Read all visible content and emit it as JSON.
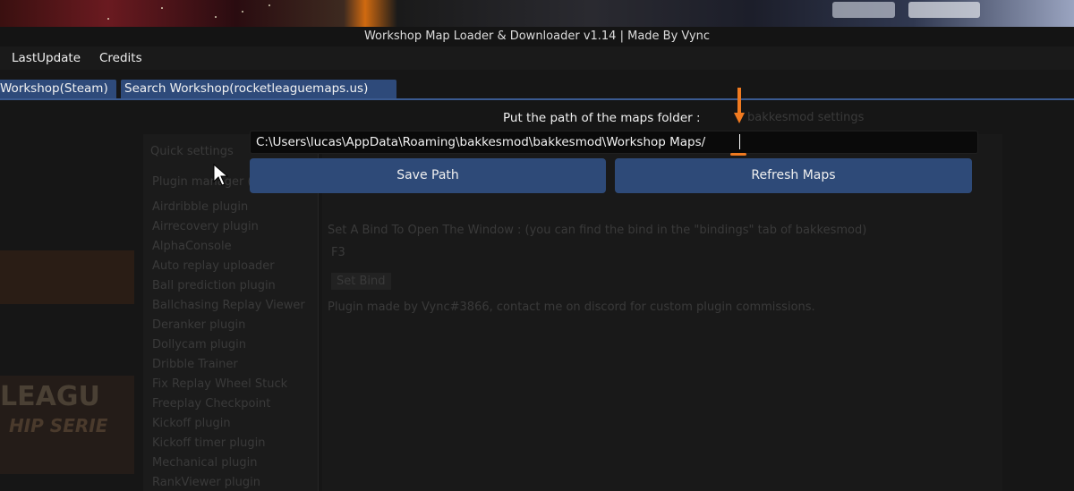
{
  "window": {
    "title": "Workshop Map Loader & Downloader v1.14 | Made By Vync"
  },
  "menu": {
    "items": [
      "LastUpdate",
      "Credits"
    ]
  },
  "tabs": [
    {
      "label": "Workshop(Steam)"
    },
    {
      "label": "Search Workshop(rocketleaguemaps.us)"
    }
  ],
  "main": {
    "prompt": "Put the path of the maps folder :",
    "path_value": "C:\\Users\\lucas\\AppData\\Roaming\\bakkesmod\\bakkesmod\\Workshop Maps/",
    "save_label": "Save Path",
    "refresh_label": "Refresh Maps"
  },
  "background_window": {
    "header": "bakkesmod settings",
    "quick_settings": "Quick settings",
    "plugin_manager": "Plugin manager (beta)",
    "plugins": [
      "Airdribble plugin",
      "Airrecovery plugin",
      "AlphaConsole",
      "Auto replay uploader",
      "Ball prediction plugin",
      "Ballchasing Replay Viewer",
      "Deranker plugin",
      "Dollycam plugin",
      "Dribble Trainer",
      "Fix Replay Wheel Stuck",
      "Freeplay Checkpoint",
      "Kickoff plugin",
      "Kickoff timer plugin",
      "Mechanical plugin",
      "RankViewer plugin"
    ],
    "bind_text": "Set A Bind To Open The Window : (you can find the bind in the \"bindings\" tab of bakkesmod)",
    "bind_key": "F3",
    "set_bind": "Set Bind",
    "footer": "Plugin made by Vync#3866, contact me on discord for custom plugin commissions.",
    "league_text": "LEAGU",
    "series_text": "HIP SERIE"
  },
  "colors": {
    "accent": "#2e4a78",
    "annotation": "#f07a20"
  }
}
